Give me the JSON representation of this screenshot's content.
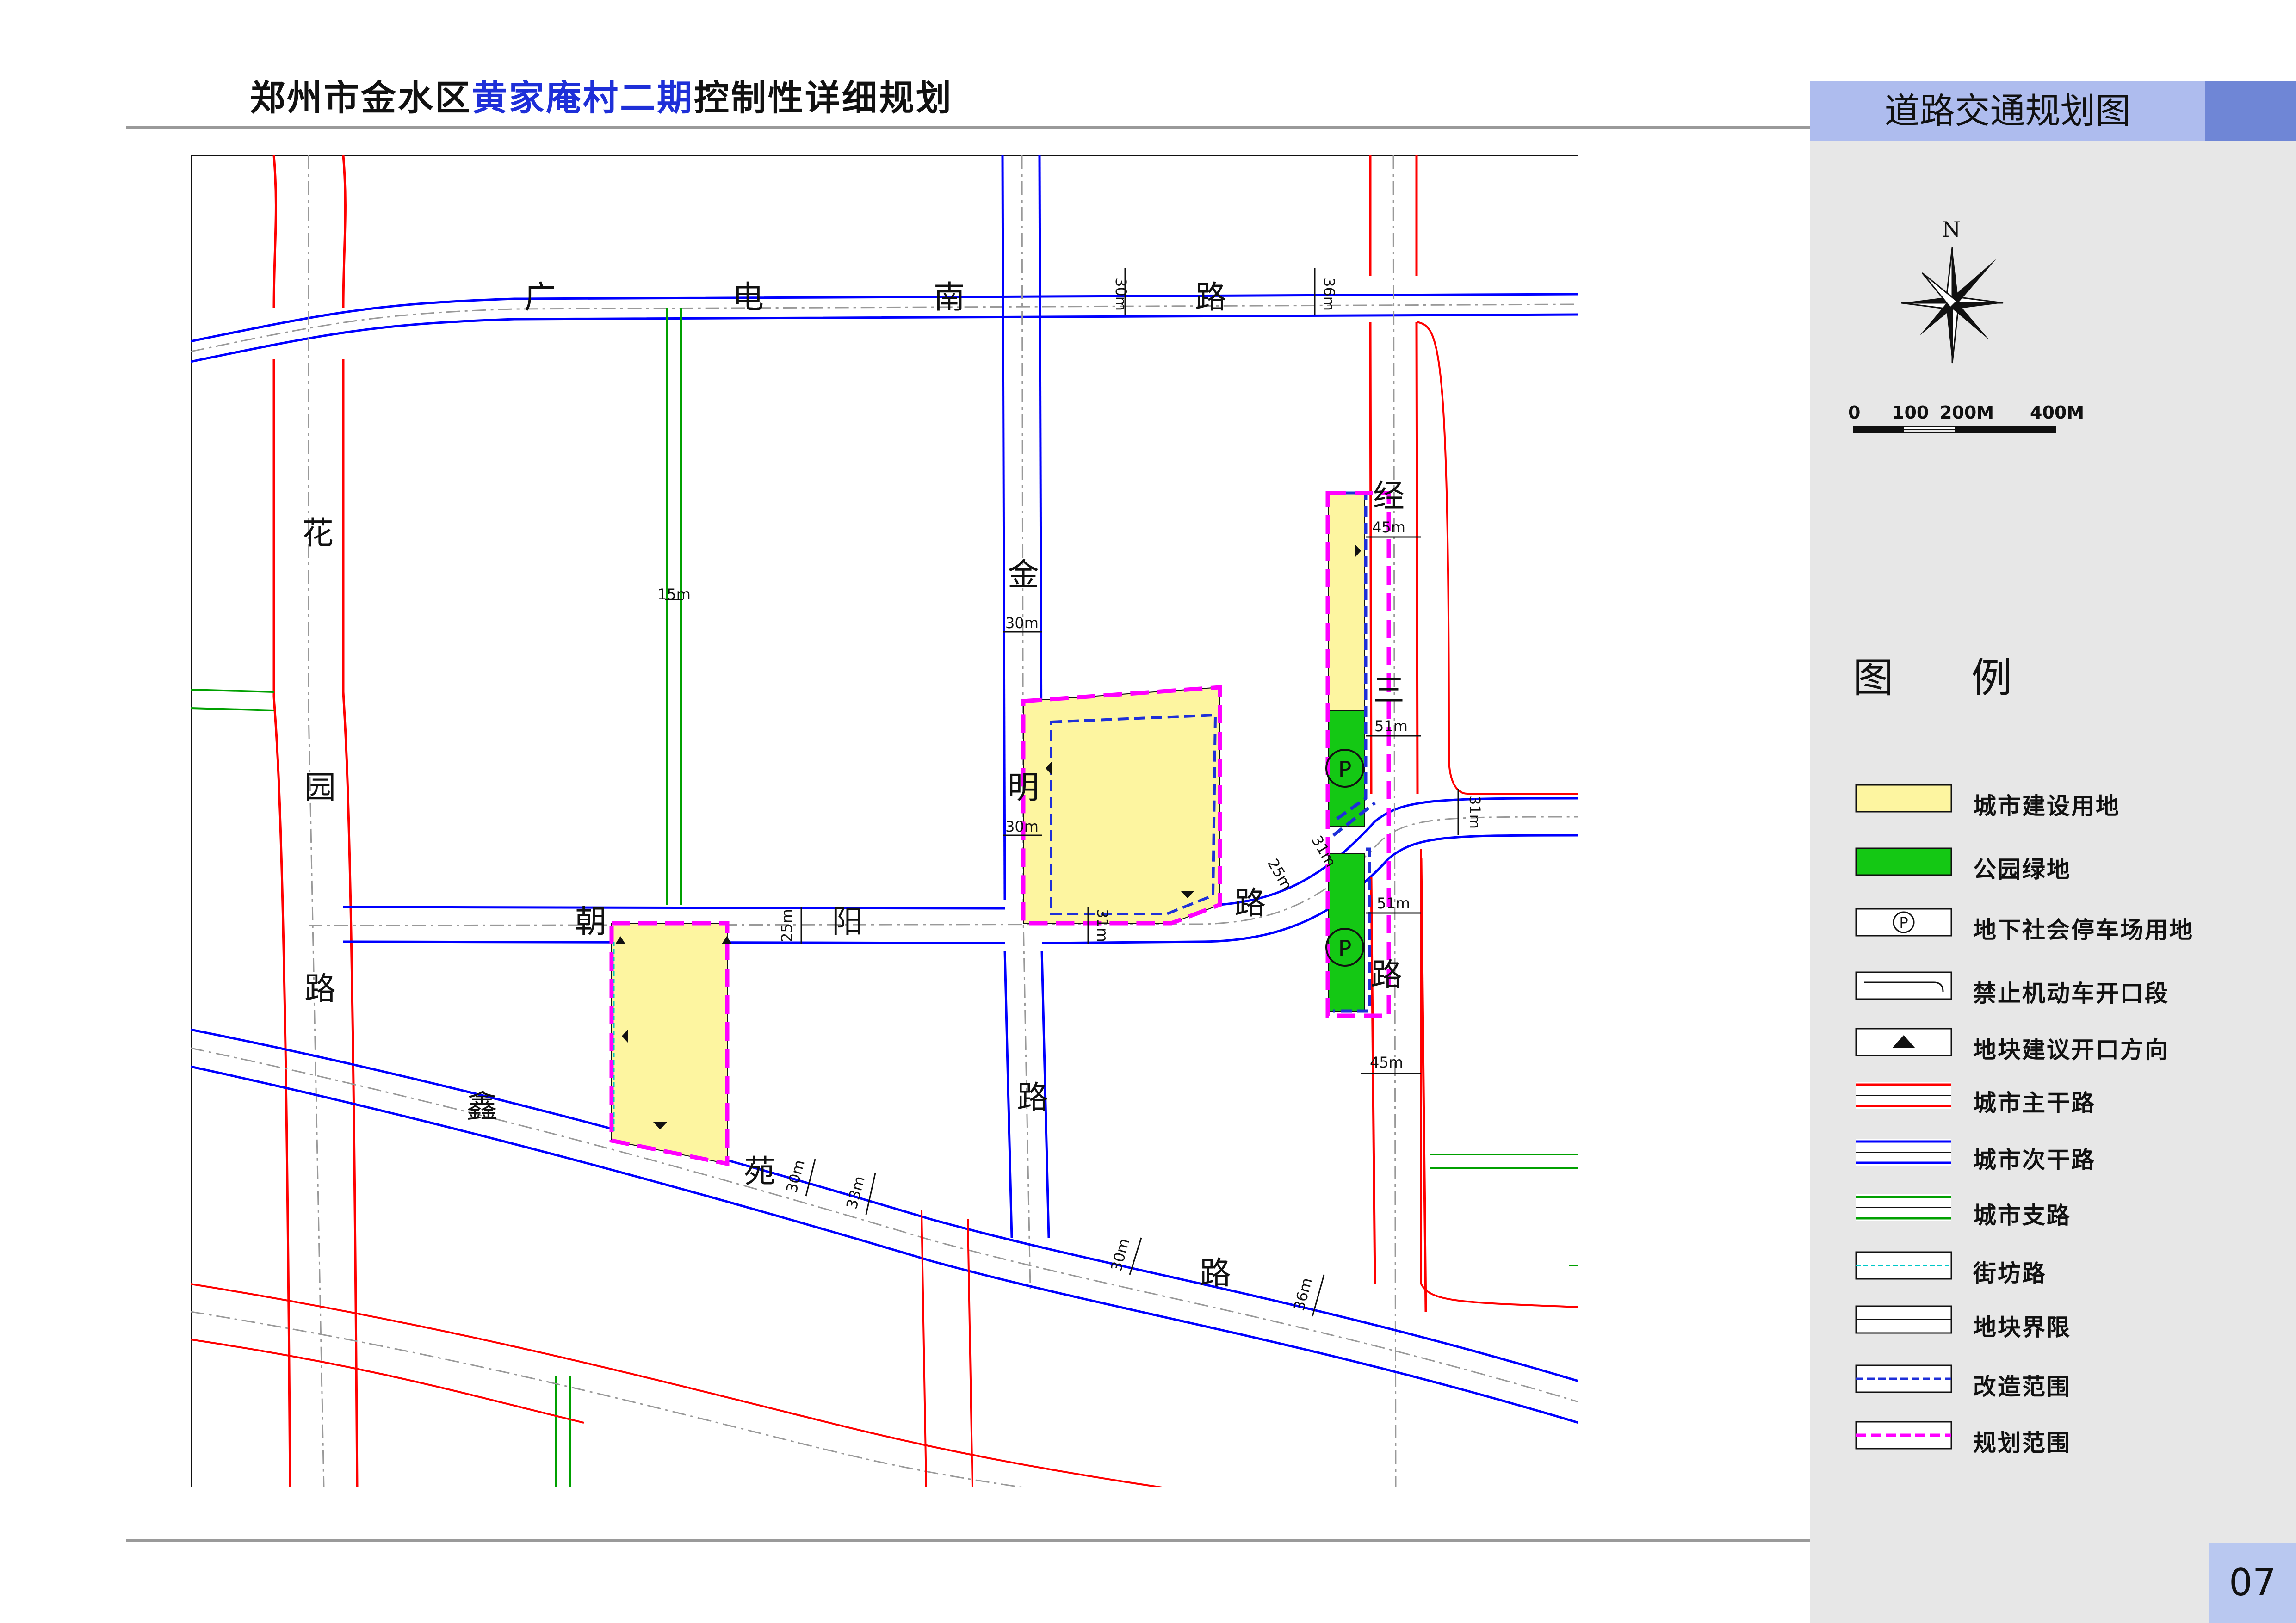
{
  "header": {
    "title_part1": "郑州市金水区",
    "title_part2": "黄家庵村二期",
    "title_part3": "控制性详细规划"
  },
  "sheet": {
    "title": "道路交通规划图",
    "page_number": "07"
  },
  "compass": {
    "north_label": "N"
  },
  "scale": {
    "labels": [
      "0",
      "100",
      "200M",
      "400M"
    ]
  },
  "roads": {
    "guangdian": [
      "广",
      "电",
      "南",
      "路"
    ],
    "huayuan": [
      "花",
      "园",
      "路"
    ],
    "jinming": [
      "金",
      "明",
      "路"
    ],
    "jingsan": [
      "经",
      "三",
      "路"
    ],
    "chaoyang": [
      "朝",
      "阳",
      "路"
    ],
    "xinyuan": [
      "鑫",
      "苑",
      "路"
    ]
  },
  "road_widths": {
    "w30a": "30m",
    "w36a": "36m",
    "w15": "15m",
    "w30b": "30m",
    "w45a": "45m",
    "w51a": "51m",
    "w31a": "31m",
    "w30c": "30m",
    "w31b": "31m",
    "w25a": "25m",
    "w51b": "51m",
    "w25b": "25m",
    "w31c": "31m",
    "w45b": "45m",
    "w30d": "30m",
    "w33": "33m",
    "w30e": "30m",
    "w36b": "36m"
  },
  "legend": {
    "title": "图    例",
    "items": [
      {
        "label": "城市建设用地",
        "swatch": "yellow-fill",
        "color": "#fdf5a0"
      },
      {
        "label": "公园绿地",
        "swatch": "green-fill",
        "color": "#14c814"
      },
      {
        "label": "地下社会停车场用地",
        "swatch": "parking-symbol",
        "color": "#000000"
      },
      {
        "label": "禁止机动车开口段",
        "swatch": "no-entry-line",
        "color": "#000000"
      },
      {
        "label": "地块建议开口方向",
        "swatch": "triangle-arrow",
        "color": "#000000"
      },
      {
        "label": "城市主干路",
        "swatch": "red-double-line",
        "color": "#ff0000"
      },
      {
        "label": "城市次干路",
        "swatch": "blue-double-line",
        "color": "#0000ff"
      },
      {
        "label": "城市支路",
        "swatch": "green-double-line",
        "color": "#00a000"
      },
      {
        "label": "街坊路",
        "swatch": "cyan-dashed-line",
        "color": "#00c8c8"
      },
      {
        "label": "地块界限",
        "swatch": "black-double-line",
        "color": "#000000"
      },
      {
        "label": "改造范围",
        "swatch": "blue-dashed-line",
        "color": "#1e2fd8"
      },
      {
        "label": "规划范围",
        "swatch": "magenta-dashed-line",
        "color": "#ff00ff"
      }
    ]
  },
  "colors": {
    "built_land": "#fdf5a0",
    "park_green": "#14c814",
    "arterial": "#ff0000",
    "secondary": "#0000ff",
    "branch": "#00a000",
    "planning_boundary": "#ff00ff",
    "renovation_boundary": "#1e2fd8"
  }
}
